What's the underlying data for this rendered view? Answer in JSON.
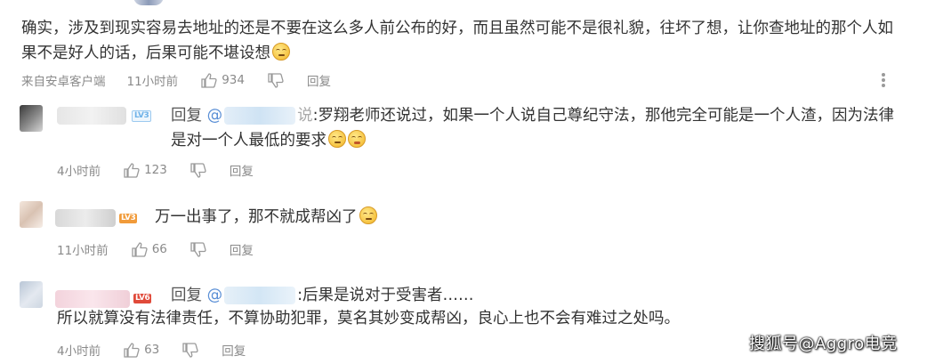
{
  "main_comment": {
    "text": "确实，涉及到现实容易去地址的还是不要在这么多人前公布的好，而且虽然可能不是很礼貌，往坏了想，让你查地址的那个人如果不是好人的话，后果可能不堪设想",
    "source": "来自安卓客户端",
    "time": "11小时前",
    "likes": "934",
    "reply_label": "回复"
  },
  "replies": [
    {
      "level": "LV3",
      "reply_prefix": "回复",
      "mention_at": "@",
      "mention_tail": "说",
      "text": ":罗翔老师还说过，如果一个人说自己尊纪守法，那他完全可能是一个人渣，因为法律是对一个人最低的要求",
      "time": "4小时前",
      "likes": "123",
      "reply_label": "回复"
    },
    {
      "level": "LV3",
      "text": "万一出事了，那不就成帮凶了",
      "time": "11小时前",
      "likes": "66",
      "reply_label": "回复"
    },
    {
      "level": "LV6",
      "reply_prefix": "回复",
      "mention_at": "@",
      "text_line1": ":后果是说对于受害者……",
      "text_line2": "所以就算没有法律责任，不算协助犯罪，莫名其妙变成帮凶，良心上也不会有难过之处吗。",
      "time": "4小时前",
      "likes": "63",
      "reply_label": "回复"
    }
  ],
  "watermark": "搜狐号@Aggro电竞",
  "icons": {
    "like": "thumbs-up-icon",
    "dislike": "thumbs-down-icon",
    "more": "vertical-dots-icon",
    "emoji": "emoji-icon"
  }
}
